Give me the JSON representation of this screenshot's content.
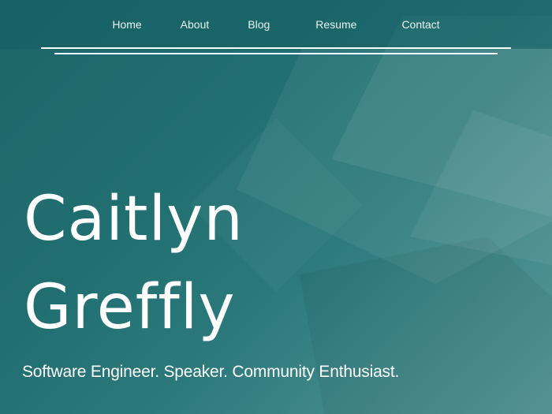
{
  "nav": {
    "items": [
      {
        "label": "Home"
      },
      {
        "label": "About"
      },
      {
        "label": "Blog"
      },
      {
        "label": "Resume"
      },
      {
        "label": "Contact"
      }
    ]
  },
  "hero": {
    "first_name": "Caitlyn",
    "last_name": "Greffly",
    "tagline": "Software Engineer. Speaker. Community Enthusiast."
  },
  "colors": {
    "background_dark": "#1e6668",
    "background_light": "#5a9a9b",
    "text": "#ffffff"
  }
}
